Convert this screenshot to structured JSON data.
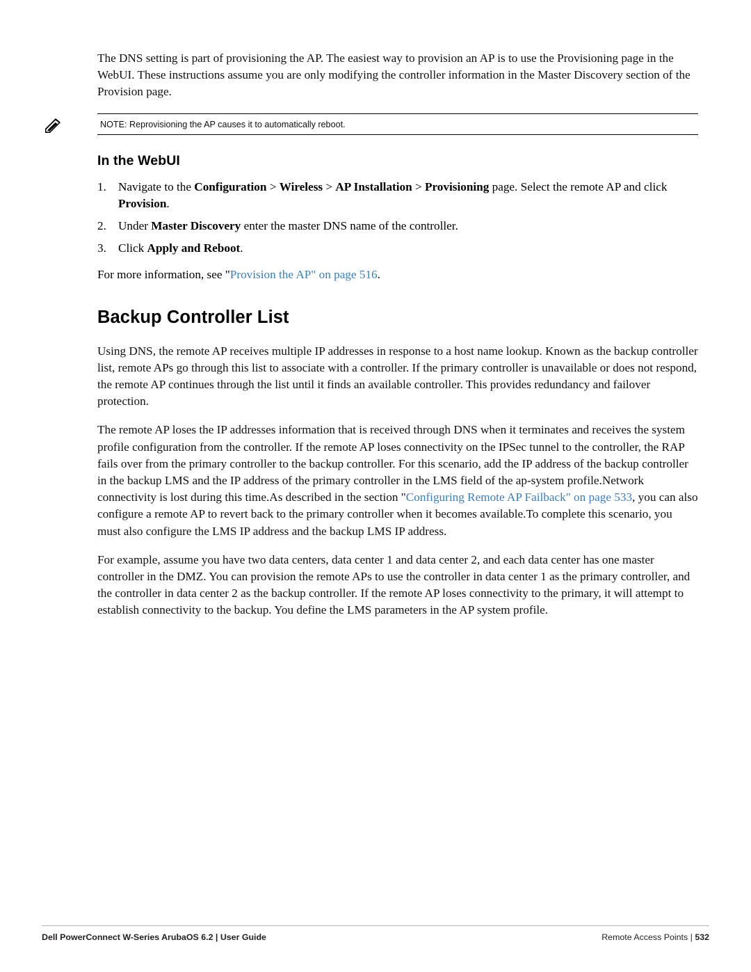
{
  "intro": {
    "paragraph": "The DNS setting is part of provisioning the AP. The easiest way to provision an AP is to use the Provisioning page in the WebUI. These instructions assume you are only modifying the controller information in the Master Discovery section of the Provision page."
  },
  "note": {
    "icon": "note-pencil-icon",
    "text": "NOTE: Reprovisioning the AP causes it to automatically reboot."
  },
  "webui": {
    "heading": "In the WebUI",
    "steps": [
      {
        "num": "1.",
        "parts": [
          {
            "t": "Navigate to the ",
            "s": "plain"
          },
          {
            "t": "Configuration",
            "s": "bold"
          },
          {
            "t": " > ",
            "s": "plain"
          },
          {
            "t": "Wireless",
            "s": "bold"
          },
          {
            "t": " > ",
            "s": "plain"
          },
          {
            "t": "AP Installation",
            "s": "bold"
          },
          {
            "t": " > ",
            "s": "plain"
          },
          {
            "t": "Provisioning",
            "s": "bold"
          },
          {
            "t": " page. Select the remote AP and click ",
            "s": "plain"
          },
          {
            "t": "Provision",
            "s": "bold"
          },
          {
            "t": ".",
            "s": "plain"
          }
        ]
      },
      {
        "num": "2.",
        "parts": [
          {
            "t": "Under ",
            "s": "plain"
          },
          {
            "t": "Master Discovery",
            "s": "bold"
          },
          {
            "t": " enter the master DNS name of the controller.",
            "s": "plain"
          }
        ]
      },
      {
        "num": "3.",
        "parts": [
          {
            "t": "Click ",
            "s": "plain"
          },
          {
            "t": "Apply and Reboot",
            "s": "bold"
          },
          {
            "t": ".",
            "s": "plain"
          }
        ]
      }
    ],
    "more_info": [
      {
        "t": "For more information, see \"",
        "s": "plain"
      },
      {
        "t": "Provision the AP\" on page 516",
        "s": "link"
      },
      {
        "t": ".",
        "s": "plain"
      }
    ]
  },
  "backup": {
    "heading": "Backup Controller List",
    "p1": "Using DNS, the remote AP receives multiple IP addresses in response to a host name lookup. Known as the backup controller list, remote APs go through this list to associate with a controller. If the primary controller is unavailable or does not respond, the remote AP continues through the list until it finds an available controller. This provides redundancy and failover protection.",
    "p2_parts": [
      {
        "t": "The remote AP loses the IP addresses information that is received through DNS when it terminates and receives the system profile configuration from the controller. If the remote AP loses connectivity on the IPSec tunnel to the controller, the RAP fails over from the primary controller to the backup controller. For this scenario, add the IP address of the backup controller in the backup LMS and the IP address of the primary controller in the LMS field of the ap-system profile.Network connectivity is lost during this time.As described in the section \"",
        "s": "plain"
      },
      {
        "t": "Configuring Remote AP Failback\" on page 533",
        "s": "link"
      },
      {
        "t": ", you can also configure a remote AP to revert back to the primary controller when it becomes available.To complete this scenario, you must also configure the LMS IP address and the backup LMS IP address.",
        "s": "plain"
      }
    ],
    "p3": "For example, assume you have two data centers, data center 1 and data center 2, and each data center has one master controller in the DMZ. You can provision the remote APs to use the controller in data center 1 as the primary controller, and the controller in data center 2 as the backup controller. If the remote AP loses connectivity to the primary, it will attempt to establish connectivity to the backup. You define the LMS parameters in the AP system profile."
  },
  "footer": {
    "left": "Dell PowerConnect W-Series ArubaOS 6.2 | User Guide",
    "right_label": "Remote Access Points  |",
    "page_number": "532"
  }
}
